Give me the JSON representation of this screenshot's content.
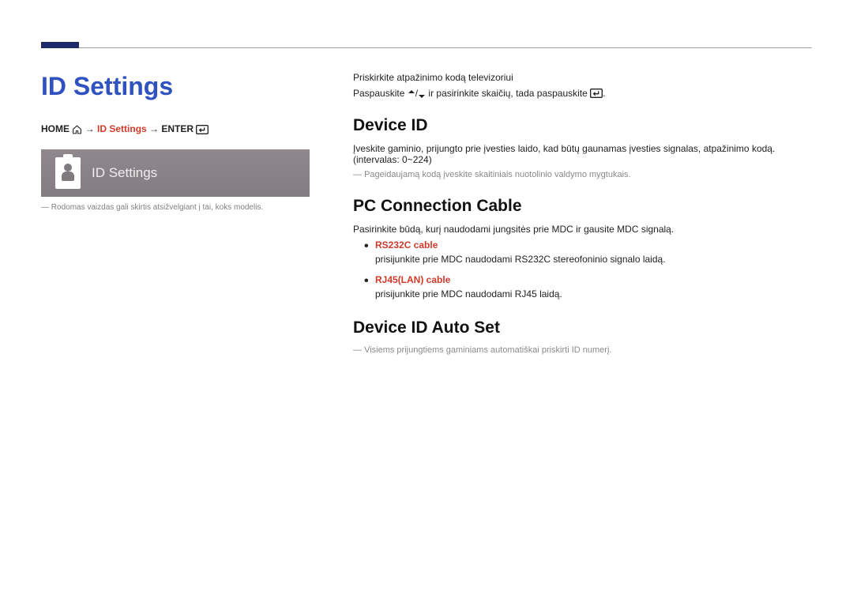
{
  "page_title": "ID Settings",
  "breadcrumb": {
    "home": "HOME",
    "mid": "ID Settings",
    "enter": "ENTER",
    "arrow": "→"
  },
  "screenshot": {
    "label": "ID Settings"
  },
  "left_footnote": "Rodomas vaizdas gali skirtis atsižvelgiant į tai, koks modelis.",
  "intro": {
    "line1": "Priskirkite atpažinimo kodą televizoriui",
    "line2a": "Paspauskite ",
    "line2b": " ir pasirinkite skaičių, tada paspauskite "
  },
  "sections": {
    "device_id": {
      "heading": "Device ID",
      "body": "Įveskite gaminio, prijungto prie įvesties laido, kad būtų gaunamas įvesties signalas, atpažinimo kodą. (intervalas: 0~224)",
      "note": "Pageidaujamą kodą įveskite skaitiniais nuotolinio valdymo mygtukais."
    },
    "pc_conn": {
      "heading": "PC Connection Cable",
      "body": "Pasirinkite būdą, kurį naudodami jungsitės prie MDC ir gausite MDC signalą.",
      "items": [
        {
          "title": "RS232C cable",
          "desc": "prisijunkite prie MDC naudodami RS232C stereofoninio signalo laidą."
        },
        {
          "title": "RJ45(LAN) cable",
          "desc": "prisijunkite prie MDC naudodami RJ45 laidą."
        }
      ]
    },
    "auto_set": {
      "heading": "Device ID Auto Set",
      "note": "Visiems prijungtiems gaminiams automatiškai priskirti ID numerį."
    }
  }
}
